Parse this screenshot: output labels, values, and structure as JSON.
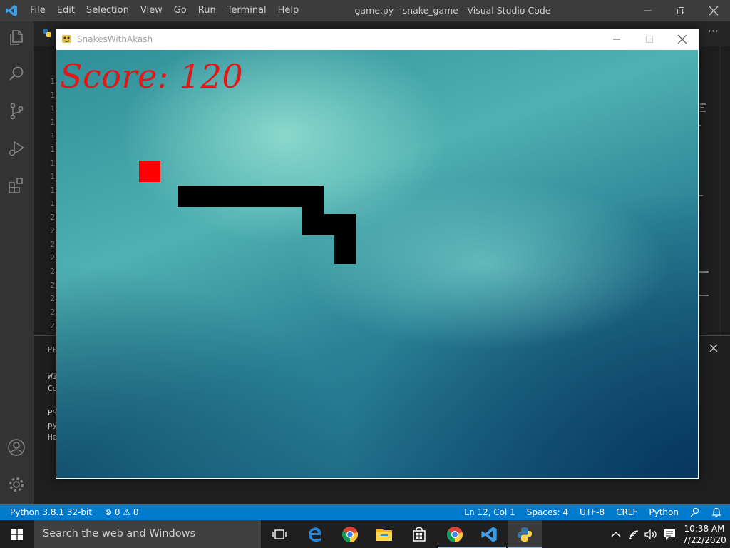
{
  "vscode": {
    "menu": [
      "File",
      "Edit",
      "Selection",
      "View",
      "Go",
      "Run",
      "Terminal",
      "Help"
    ],
    "window_title": "game.py - snake_game - Visual Studio Code",
    "line_numbers": [
      "1",
      "1",
      "1",
      "1",
      "1",
      "1",
      "1",
      "1",
      "1",
      "1",
      "2",
      "2",
      "2",
      "2",
      "2",
      "2",
      "2",
      "2",
      "2",
      "2"
    ],
    "panel_label": "PR",
    "terminal_lines": [
      "Wi",
      "Co",
      "",
      "PS",
      "py",
      "He"
    ]
  },
  "statusbar": {
    "interpreter": "Python 3.8.1 32-bit",
    "problems": "⊗ 0 ⚠ 0",
    "cursor": "Ln 12, Col 1",
    "spaces": "Spaces: 4",
    "encoding": "UTF-8",
    "eol": "CRLF",
    "language": "Python"
  },
  "taskbar": {
    "search_placeholder": "Search the web and Windows",
    "time": "10:38 AM",
    "date": "7/22/2020"
  },
  "game": {
    "window_title": "SnakesWithAkash",
    "score_text": "Score: 120"
  },
  "colors": {
    "statusbar": "#007acc",
    "score": "#e01818",
    "food": "#ff0000",
    "snake": "#000000"
  }
}
